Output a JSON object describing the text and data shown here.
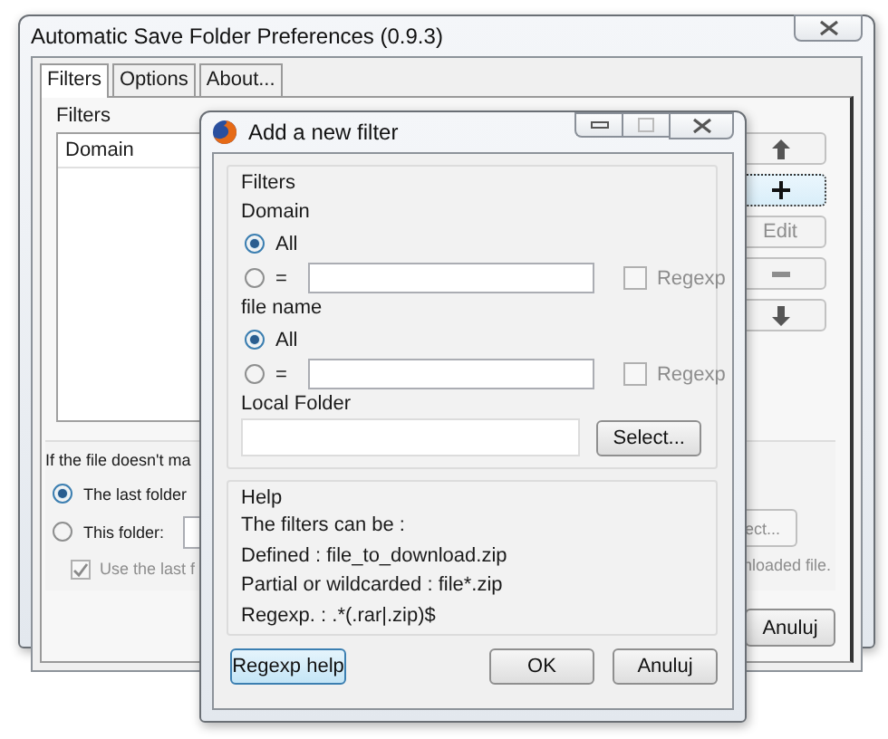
{
  "main_window": {
    "title": "Automatic Save Folder Preferences (0.9.3)",
    "tabs": [
      {
        "label": "Filters",
        "selected": true
      },
      {
        "label": "Options",
        "selected": false
      },
      {
        "label": "About...",
        "selected": false
      }
    ],
    "filters_group": {
      "label": "Filters",
      "list_columns": [
        "Domain"
      ]
    },
    "side_buttons": [
      {
        "kind": "up-arrow",
        "disabled": false
      },
      {
        "kind": "plus",
        "disabled": false,
        "focused": true
      },
      {
        "kind": "text",
        "label": "Edit",
        "disabled": true
      },
      {
        "kind": "minus",
        "disabled": true
      },
      {
        "kind": "down-arrow",
        "disabled": false
      }
    ],
    "fallback": {
      "label": "If the file doesn't ma",
      "options": [
        {
          "label": "The last folder",
          "selected": true
        },
        {
          "label": "This folder:",
          "selected": false
        }
      ],
      "checkbox": {
        "label": "Use the last f",
        "checked": true,
        "disabled": true
      },
      "browse_button": "ect...",
      "note": "nloaded file."
    },
    "buttons": [
      "Anuluj"
    ]
  },
  "dialog": {
    "title": "Add a new filter",
    "filters_group": {
      "label": "Filters",
      "sections": [
        {
          "label": "Domain",
          "options": [
            {
              "label": "All",
              "selected": true
            },
            {
              "label": "=",
              "selected": false
            }
          ],
          "regexp": {
            "label": "Regexp",
            "checked": false,
            "disabled": true
          }
        },
        {
          "label": "file name",
          "options": [
            {
              "label": "All",
              "selected": true
            },
            {
              "label": "=",
              "selected": false
            }
          ],
          "regexp": {
            "label": "Regexp",
            "checked": false,
            "disabled": true
          }
        }
      ],
      "local_folder": {
        "label": "Local Folder",
        "button": "Select..."
      }
    },
    "help_group": {
      "label": "Help",
      "lines": [
        "The filters can be :",
        "Defined : file_to_download.zip",
        "Partial or wildcarded : file*.zip",
        "Regexp. : .*(.rar|.zip)$"
      ]
    },
    "help_button": {
      "label": "Regexp help",
      "focused": true
    },
    "buttons": [
      "OK",
      "Anuluj"
    ]
  }
}
